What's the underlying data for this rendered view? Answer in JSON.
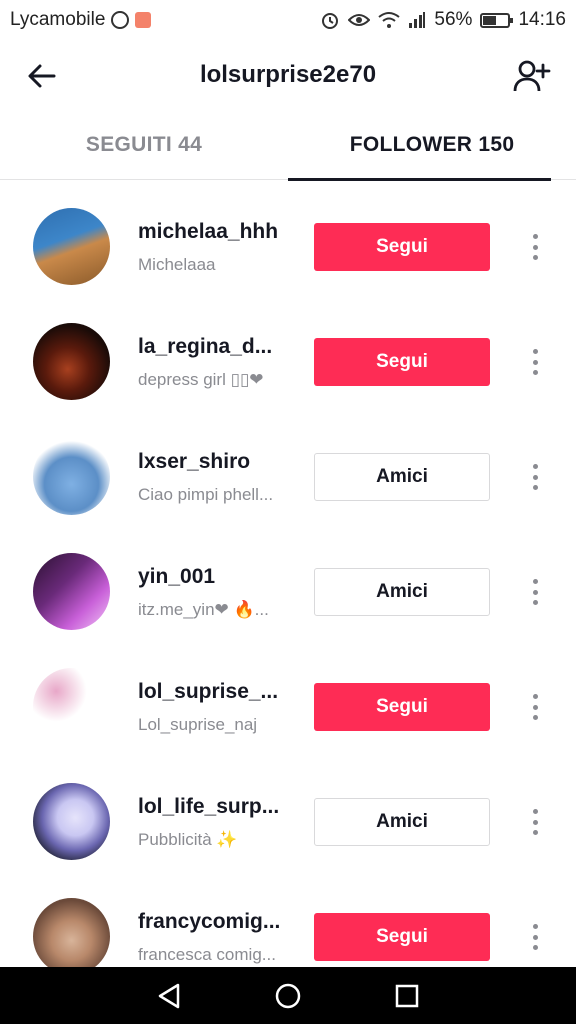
{
  "status_bar": {
    "carrier": "Lycamobile",
    "battery": "56%",
    "battery_level": 0.56,
    "time": "14:16"
  },
  "header": {
    "title": "lolsurprise2e70"
  },
  "tabs": [
    {
      "label": "SEGUITI 44",
      "active": false
    },
    {
      "label": "FOLLOWER 150",
      "active": true
    }
  ],
  "followers": [
    {
      "username": "michelaa_hhh",
      "nickname": "Michelaaa",
      "button": "Segui",
      "type": "follow",
      "avatar_colors": [
        "#2f6fb0",
        "#c9894a"
      ]
    },
    {
      "username": "la_regina_d...",
      "nickname": "depress girl ▯▯❤",
      "button": "Segui",
      "type": "follow",
      "avatar_colors": [
        "#1a0b08",
        "#a8401f"
      ]
    },
    {
      "username": "lxser_shiro",
      "nickname": "Ciao pimpi phell...",
      "button": "Amici",
      "type": "friends",
      "avatar_colors": [
        "#5c8fc7",
        "#ffffff"
      ]
    },
    {
      "username": "yin_001",
      "nickname": "itz.me_yin❤ 🔥...",
      "button": "Amici",
      "type": "friends",
      "avatar_colors": [
        "#2a1030",
        "#c85fd8"
      ]
    },
    {
      "username": "lol_suprise_...",
      "nickname": "Lol_suprise_naj",
      "button": "Segui",
      "type": "follow",
      "avatar_colors": [
        "#ffffff",
        "#e8a7c8"
      ]
    },
    {
      "username": "lol_life_surp...",
      "nickname": "Pubblicità ✨",
      "button": "Amici",
      "type": "friends",
      "avatar_colors": [
        "#1b1d2a",
        "#c9c7f2"
      ]
    },
    {
      "username": "francycomig...",
      "nickname": "francesca comig...",
      "button": "Segui",
      "type": "follow",
      "avatar_colors": [
        "#6b4a3a",
        "#d8b49a"
      ]
    }
  ],
  "colors": {
    "accent": "#fe2c55",
    "text": "#161823",
    "secondary_text": "#8a8b91"
  }
}
